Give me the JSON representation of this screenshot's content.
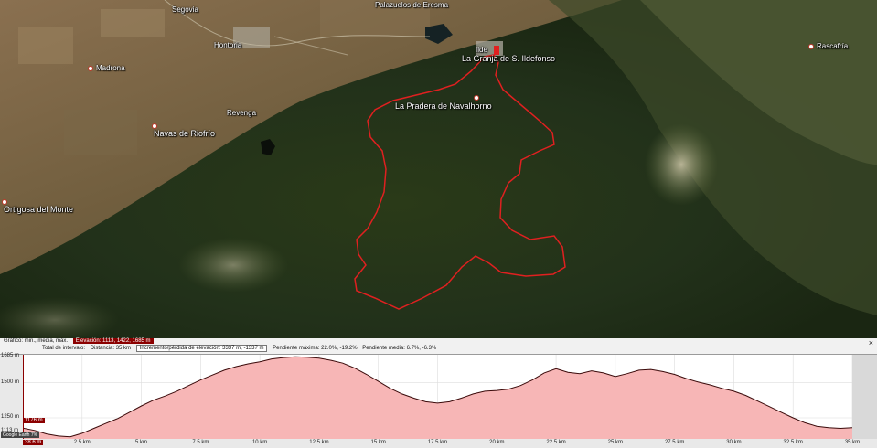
{
  "places": {
    "segovia": "Segovia",
    "hontoria": "Hontoria",
    "madrona": "Madrona",
    "revenga": "Revenga",
    "navas": "Navas de Riofrío",
    "ortigosa": "Ortigosa del Monte",
    "pradera": "La Pradera de Navalhorno",
    "granja": "La Granja de S. Ildefonso",
    "palazuelos": "Palazuelos de Eresma",
    "rascafria": "Rascafría",
    "granja_small": "Ilde"
  },
  "panel": {
    "graph_label": "Gráfico: min., media, máx.",
    "elevation_label": "Elevación: 1113, 1422, 1685 m",
    "total_label": "Total de intervalo:",
    "distance": "Distancia: 35 km",
    "gain_loss": "Incremento/pérdida de elevación: 3337 m, -1337 m",
    "max_slope": "Pendiente máxima: 22.0%, -19.2%",
    "avg_slope": "Pendiente media: 6.7%, -6.3%",
    "close": "×",
    "cursor_elev": "1176 m",
    "cursor_dist": "38.6 m",
    "cursor_slope": "Google Earth 7%",
    "min_tick": "1113 m"
  },
  "chart_data": {
    "type": "area",
    "xlabel": "",
    "ylabel": "",
    "x_ticks": [
      "2.5 km",
      "5 km",
      "7.5 km",
      "10 km",
      "12.5 km",
      "15 km",
      "17.5 km",
      "20 km",
      "22.5 km",
      "25 km",
      "27.5 km",
      "30 km",
      "32.5 km",
      "35 km"
    ],
    "y_ticks": [
      "1685 m",
      "1500 m",
      "1250 m"
    ],
    "xlim": [
      0,
      35
    ],
    "ylim": [
      1100,
      1700
    ],
    "series": [
      {
        "x": [
          0,
          0.5,
          1,
          1.5,
          2,
          2.5,
          3,
          3.5,
          4,
          4.5,
          5,
          5.5,
          6,
          6.5,
          7,
          7.5,
          8,
          8.5,
          9,
          9.5,
          10,
          10.5,
          11,
          11.5,
          12,
          12.5,
          13,
          13.5,
          14,
          14.5,
          15,
          15.5,
          16,
          16.5,
          17,
          17.5,
          18,
          18.5,
          19,
          19.5,
          20,
          20.5,
          21,
          21.5,
          22,
          22.5,
          23,
          23.5,
          24,
          24.5,
          25,
          25.5,
          26,
          26.5,
          27,
          27.5,
          28,
          28.5,
          29,
          29.5,
          30,
          30.5,
          31,
          31.5,
          32,
          32.5,
          33,
          33.5,
          34,
          34.5,
          35
        ],
        "values": [
          1176,
          1160,
          1135,
          1120,
          1115,
          1140,
          1175,
          1210,
          1245,
          1290,
          1335,
          1375,
          1405,
          1440,
          1480,
          1520,
          1555,
          1590,
          1615,
          1635,
          1650,
          1670,
          1680,
          1685,
          1682,
          1675,
          1660,
          1640,
          1605,
          1560,
          1510,
          1460,
          1420,
          1390,
          1365,
          1355,
          1365,
          1390,
          1420,
          1440,
          1445,
          1455,
          1480,
          1520,
          1570,
          1600,
          1575,
          1565,
          1585,
          1570,
          1545,
          1565,
          1590,
          1595,
          1580,
          1560,
          1530,
          1505,
          1485,
          1460,
          1440,
          1410,
          1370,
          1330,
          1290,
          1250,
          1215,
          1190,
          1180,
          1175,
          1180
        ]
      }
    ]
  }
}
